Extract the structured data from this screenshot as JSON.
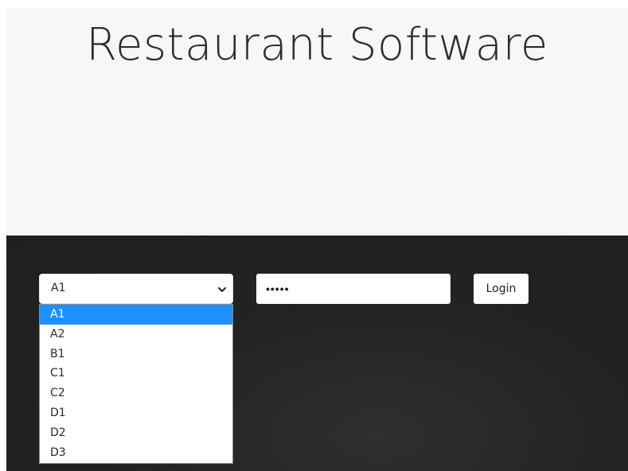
{
  "hero": {
    "title": "Restaurant Software"
  },
  "login": {
    "table_select": {
      "selected": "A1",
      "options": [
        "A1",
        "A2",
        "B1",
        "C1",
        "C2",
        "D1",
        "D2",
        "D3"
      ],
      "highlighted_option": "A1"
    },
    "password": {
      "masked_value": "•••••"
    },
    "login_button_label": "Login"
  },
  "colors": {
    "hero_background": "#f7f7f7",
    "band_background": "#222222",
    "highlight": "#1e90ff"
  },
  "icons": {
    "select_arrow": "chevron-down-icon"
  }
}
